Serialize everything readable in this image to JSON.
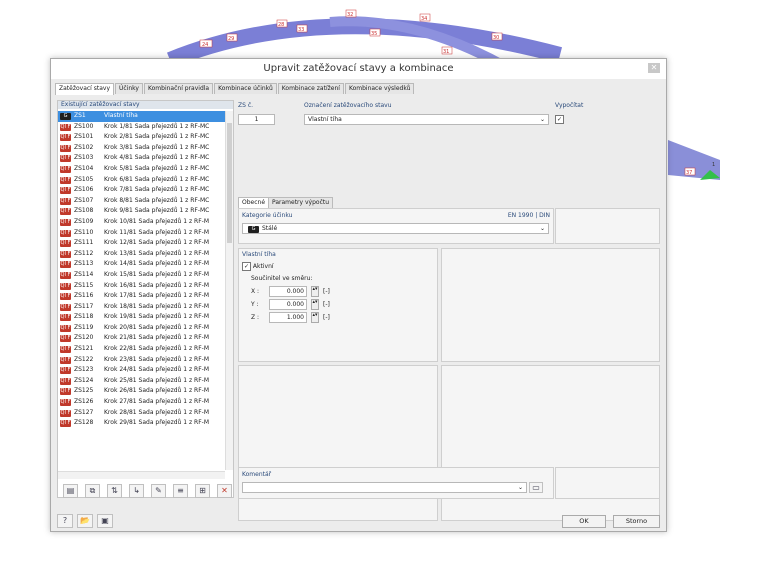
{
  "window_title": "Upravit zatěžovací stavy a kombinace",
  "tabs": [
    "Zatěžovací stavy",
    "Účinky",
    "Kombinační pravidla",
    "Kombinace účinků",
    "Kombinace zatížení",
    "Kombinace výsledků"
  ],
  "background_labels": [
    "32",
    "34",
    "28",
    "33",
    "35",
    "30",
    "24",
    "29",
    "31",
    "37",
    "1"
  ],
  "left": {
    "header": "Existující zatěžovací stavy",
    "rows": [
      {
        "badge": "G",
        "id": "ZS1",
        "desc": "Vlastní tíha"
      },
      {
        "badge": "QI F",
        "id": "ZS100",
        "desc": "Krok 1/81 Sada přejezdů 1 z RF-MC"
      },
      {
        "badge": "QI F",
        "id": "ZS101",
        "desc": "Krok 2/81 Sada přejezdů 1 z RF-MC"
      },
      {
        "badge": "QI F",
        "id": "ZS102",
        "desc": "Krok 3/81 Sada přejezdů 1 z RF-MC"
      },
      {
        "badge": "QI F",
        "id": "ZS103",
        "desc": "Krok 4/81 Sada přejezdů 1 z RF-MC"
      },
      {
        "badge": "QI F",
        "id": "ZS104",
        "desc": "Krok 5/81 Sada přejezdů 1 z RF-MC"
      },
      {
        "badge": "QI F",
        "id": "ZS105",
        "desc": "Krok 6/81 Sada přejezdů 1 z RF-MC"
      },
      {
        "badge": "QI F",
        "id": "ZS106",
        "desc": "Krok 7/81 Sada přejezdů 1 z RF-MC"
      },
      {
        "badge": "QI F",
        "id": "ZS107",
        "desc": "Krok 8/81 Sada přejezdů 1 z RF-MC"
      },
      {
        "badge": "QI F",
        "id": "ZS108",
        "desc": "Krok 9/81 Sada přejezdů 1 z RF-MC"
      },
      {
        "badge": "QI F",
        "id": "ZS109",
        "desc": "Krok 10/81 Sada přejezdů 1 z RF-M"
      },
      {
        "badge": "QI F",
        "id": "ZS110",
        "desc": "Krok 11/81 Sada přejezdů 1 z RF-M"
      },
      {
        "badge": "QI F",
        "id": "ZS111",
        "desc": "Krok 12/81 Sada přejezdů 1 z RF-M"
      },
      {
        "badge": "QI F",
        "id": "ZS112",
        "desc": "Krok 13/81 Sada přejezdů 1 z RF-M"
      },
      {
        "badge": "QI F",
        "id": "ZS113",
        "desc": "Krok 14/81 Sada přejezdů 1 z RF-M"
      },
      {
        "badge": "QI F",
        "id": "ZS114",
        "desc": "Krok 15/81 Sada přejezdů 1 z RF-M"
      },
      {
        "badge": "QI F",
        "id": "ZS115",
        "desc": "Krok 16/81 Sada přejezdů 1 z RF-M"
      },
      {
        "badge": "QI F",
        "id": "ZS116",
        "desc": "Krok 17/81 Sada přejezdů 1 z RF-M"
      },
      {
        "badge": "QI F",
        "id": "ZS117",
        "desc": "Krok 18/81 Sada přejezdů 1 z RF-M"
      },
      {
        "badge": "QI F",
        "id": "ZS118",
        "desc": "Krok 19/81 Sada přejezdů 1 z RF-M"
      },
      {
        "badge": "QI F",
        "id": "ZS119",
        "desc": "Krok 20/81 Sada přejezdů 1 z RF-M"
      },
      {
        "badge": "QI F",
        "id": "ZS120",
        "desc": "Krok 21/81 Sada přejezdů 1 z RF-M"
      },
      {
        "badge": "QI F",
        "id": "ZS121",
        "desc": "Krok 22/81 Sada přejezdů 1 z RF-M"
      },
      {
        "badge": "QI F",
        "id": "ZS122",
        "desc": "Krok 23/81 Sada přejezdů 1 z RF-M"
      },
      {
        "badge": "QI F",
        "id": "ZS123",
        "desc": "Krok 24/81 Sada přejezdů 1 z RF-M"
      },
      {
        "badge": "QI F",
        "id": "ZS124",
        "desc": "Krok 25/81 Sada přejezdů 1 z RF-M"
      },
      {
        "badge": "QI F",
        "id": "ZS125",
        "desc": "Krok 26/81 Sada přejezdů 1 z RF-M"
      },
      {
        "badge": "QI F",
        "id": "ZS126",
        "desc": "Krok 27/81 Sada přejezdů 1 z RF-M"
      },
      {
        "badge": "QI F",
        "id": "ZS127",
        "desc": "Krok 28/81 Sada přejezdů 1 z RF-M"
      },
      {
        "badge": "QI F",
        "id": "ZS128",
        "desc": "Krok 29/81 Sada přejezdů 1 z RF-M"
      }
    ]
  },
  "right": {
    "zs_label": "ZS č.",
    "zs_value": "1",
    "name_label": "Označení zatěžovacího stavu",
    "name_value": "Vlastní tíha",
    "calc_label": "Vypočítat",
    "calc_checked": "✓",
    "subtabs": [
      "Obecné",
      "Parametry výpočtu"
    ],
    "category_label": "Kategorie účinku",
    "norm": "EN 1990 | DIN",
    "category_badge": "G",
    "category_value": "Stálé",
    "selfweight_label": "Vlastní tíha",
    "active_label": "Aktivní",
    "active_checked": "✓",
    "factor_label": "Součinitel ve směru:",
    "factors": [
      {
        "axis": "X :",
        "value": "0.000",
        "unit": "[-]"
      },
      {
        "axis": "Y :",
        "value": "0.000",
        "unit": "[-]"
      },
      {
        "axis": "Z :",
        "value": "1.000",
        "unit": "[-]"
      }
    ],
    "comment_label": "Komentář"
  },
  "footer": {
    "ok": "OK",
    "cancel": "Storno"
  }
}
